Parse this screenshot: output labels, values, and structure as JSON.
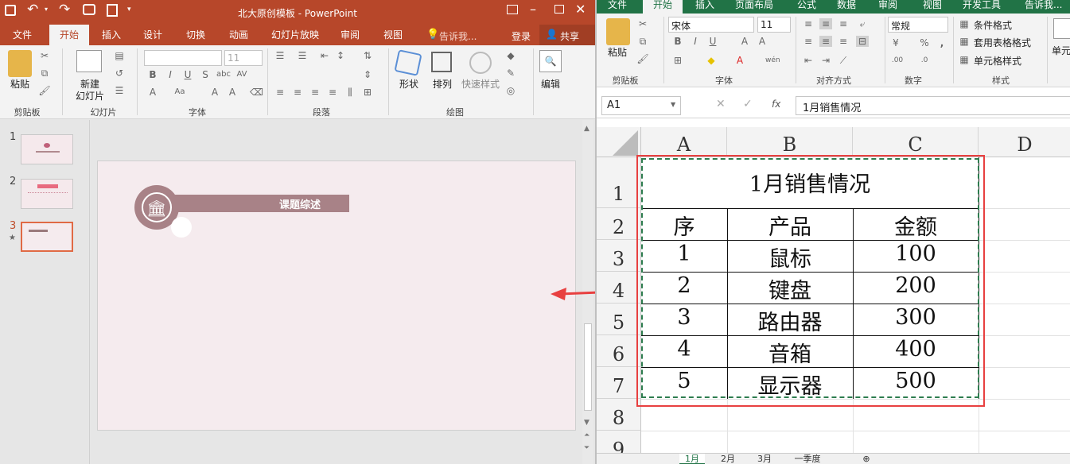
{
  "ppt": {
    "title": "北大原创模板 - PowerPoint",
    "tabs": [
      "文件",
      "开始",
      "插入",
      "设计",
      "切换",
      "动画",
      "幻灯片放映",
      "审阅",
      "视图"
    ],
    "tell_me": "告诉我...",
    "login": "登录",
    "share": "共享",
    "groups": {
      "clipboard": "剪贴板",
      "slides": "幻灯片",
      "font": "字体",
      "paragraph": "段落",
      "drawing": "绘图"
    },
    "buttons": {
      "paste": "粘贴",
      "new_slide": "新建",
      "new_slide2": "幻灯片",
      "shape": "形状",
      "arrange": "排列",
      "quick_style": "快速样式",
      "edit": "编辑"
    },
    "font_size": "11",
    "slide_numbers": [
      "1",
      "2",
      "3"
    ],
    "slide": {
      "header_label": "课题综述"
    }
  },
  "excel": {
    "tabs": [
      "文件",
      "开始",
      "插入",
      "页面布局",
      "公式",
      "数据",
      "审阅",
      "视图",
      "开发工具"
    ],
    "tell_me": "告诉我...",
    "font_name": "宋体",
    "font_size": "11",
    "number_format": "常规",
    "groups": {
      "clipboard": "剪贴板",
      "font": "字体",
      "align": "对齐方式",
      "number": "数字",
      "styles": "样式",
      "cells": "单元格"
    },
    "buttons": {
      "paste": "粘贴",
      "cond_format": "条件格式",
      "table_format": "套用表格格式",
      "cell_style": "单元格样式"
    },
    "name_box": "A1",
    "formula": "1月销售情况",
    "columns": [
      "A",
      "B",
      "C",
      "D"
    ],
    "rows": [
      "1",
      "2",
      "3",
      "4",
      "5",
      "6",
      "7",
      "8",
      "9"
    ],
    "table": {
      "title": "1月销售情况",
      "headers": [
        "序",
        "产品",
        "金额"
      ],
      "data": [
        [
          "1",
          "鼠标",
          "100"
        ],
        [
          "2",
          "键盘",
          "200"
        ],
        [
          "3",
          "路由器",
          "300"
        ],
        [
          "4",
          "音箱",
          "400"
        ],
        [
          "5",
          "显示器",
          "500"
        ]
      ]
    },
    "sheet_tabs": [
      "1月",
      "2月",
      "3月",
      "一季度"
    ]
  }
}
